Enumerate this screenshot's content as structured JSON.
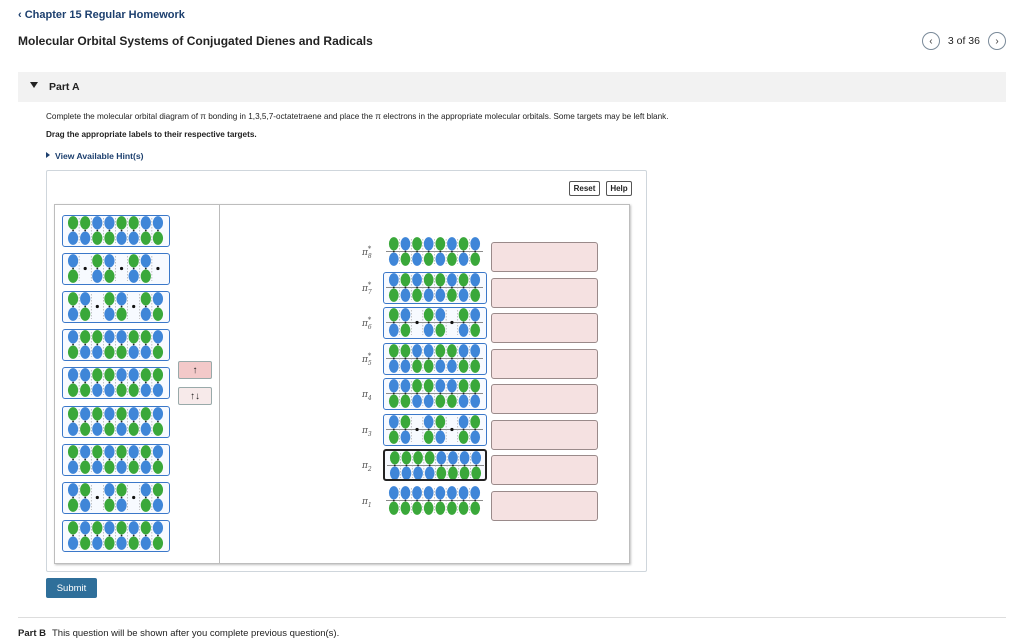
{
  "header": {
    "back_link": "Chapter 15 Regular Homework",
    "title": "Molecular Orbital Systems of Conjugated Dienes and Radicals",
    "pager": "3 of 36",
    "prev_icon": "chevron-left-icon",
    "next_icon": "chevron-right-icon"
  },
  "part_a": {
    "label": "Part A",
    "instruction": "Complete the molecular orbital diagram of π bonding in 1,3,5,7-octatetraene and place the π electrons in the appropriate molecular orbitals. Some targets may be left blank.",
    "drag_text": "Drag the appropriate labels to their respective targets.",
    "hint": "View Available Hint(s)"
  },
  "toolbar": {
    "reset": "Reset",
    "help": "Help"
  },
  "arrows": {
    "single": "↑",
    "pair": "↑↓"
  },
  "tray_tiles": [
    {
      "name": "orbital-tile-1",
      "phases": [
        1,
        1,
        -1,
        -1,
        1,
        1,
        -1,
        -1
      ],
      "nodes": []
    },
    {
      "name": "orbital-tile-2",
      "phases": [
        -1,
        0,
        1,
        -1,
        0,
        1,
        -1,
        0
      ],
      "nodes": [
        1,
        4,
        7
      ]
    },
    {
      "name": "orbital-tile-3",
      "phases": [
        1,
        -1,
        0,
        1,
        -1,
        0,
        1,
        -1
      ],
      "nodes": [
        2,
        5
      ]
    },
    {
      "name": "orbital-tile-4",
      "phases": [
        -1,
        1,
        1,
        -1,
        -1,
        1,
        1,
        -1
      ],
      "nodes": []
    },
    {
      "name": "orbital-tile-5",
      "phases": [
        -1,
        -1,
        1,
        1,
        -1,
        -1,
        1,
        1
      ],
      "nodes": []
    },
    {
      "name": "orbital-tile-6",
      "phases": [
        1,
        -1,
        1,
        -1,
        1,
        -1,
        1,
        -1
      ],
      "nodes": []
    },
    {
      "name": "orbital-tile-7",
      "phases": [
        1,
        -1,
        1,
        -1,
        1,
        -1,
        1,
        -1
      ],
      "nodes": []
    },
    {
      "name": "orbital-tile-8",
      "phases": [
        -1,
        1,
        0,
        -1,
        1,
        0,
        -1,
        1
      ],
      "nodes": [
        2,
        5
      ]
    },
    {
      "name": "orbital-tile-9",
      "phases": [
        1,
        -1,
        1,
        -1,
        1,
        -1,
        1,
        -1
      ],
      "nodes": []
    }
  ],
  "levels": [
    {
      "id": "pi8",
      "sym": "π",
      "sub": "8",
      "star": "*",
      "phases": [
        1,
        -1,
        1,
        -1,
        1,
        -1,
        1,
        -1
      ],
      "nodes": [],
      "framed": false,
      "selected": false
    },
    {
      "id": "pi7",
      "sym": "π",
      "sub": "7",
      "star": "*",
      "phases": [
        -1,
        1,
        -1,
        1,
        1,
        -1,
        1,
        -1
      ],
      "nodes": [],
      "framed": true,
      "selected": false
    },
    {
      "id": "pi6",
      "sym": "π",
      "sub": "6",
      "star": "*",
      "phases": [
        1,
        -1,
        0,
        1,
        -1,
        0,
        1,
        -1
      ],
      "nodes": [
        2,
        5
      ],
      "framed": true,
      "selected": false
    },
    {
      "id": "pi5",
      "sym": "π",
      "sub": "5",
      "star": "*",
      "phases": [
        1,
        1,
        -1,
        -1,
        1,
        1,
        -1,
        -1
      ],
      "nodes": [],
      "framed": true,
      "selected": false
    },
    {
      "id": "pi4",
      "sym": "π",
      "sub": "4",
      "star": "",
      "phases": [
        -1,
        -1,
        1,
        1,
        -1,
        -1,
        1,
        1
      ],
      "nodes": [],
      "framed": true,
      "selected": false
    },
    {
      "id": "pi3",
      "sym": "π",
      "sub": "3",
      "star": "",
      "phases": [
        -1,
        1,
        0,
        -1,
        1,
        0,
        -1,
        1
      ],
      "nodes": [
        2,
        5
      ],
      "framed": true,
      "selected": false
    },
    {
      "id": "pi2",
      "sym": "π",
      "sub": "2",
      "star": "",
      "phases": [
        1,
        1,
        1,
        1,
        -1,
        -1,
        -1,
        -1
      ],
      "nodes": [],
      "framed": true,
      "selected": true
    },
    {
      "id": "pi1",
      "sym": "π",
      "sub": "1",
      "star": "",
      "phases": [
        -1,
        -1,
        -1,
        -1,
        -1,
        -1,
        -1,
        -1
      ],
      "nodes": [],
      "framed": false,
      "selected": false
    }
  ],
  "colors": {
    "green": "#3aa83a",
    "blue": "#3f86d8",
    "frame": "#3b78c9",
    "target": "#f5e1e1"
  },
  "submit": "Submit",
  "part_b": {
    "label": "Part B",
    "text": "This question will be shown after you complete previous question(s)."
  }
}
